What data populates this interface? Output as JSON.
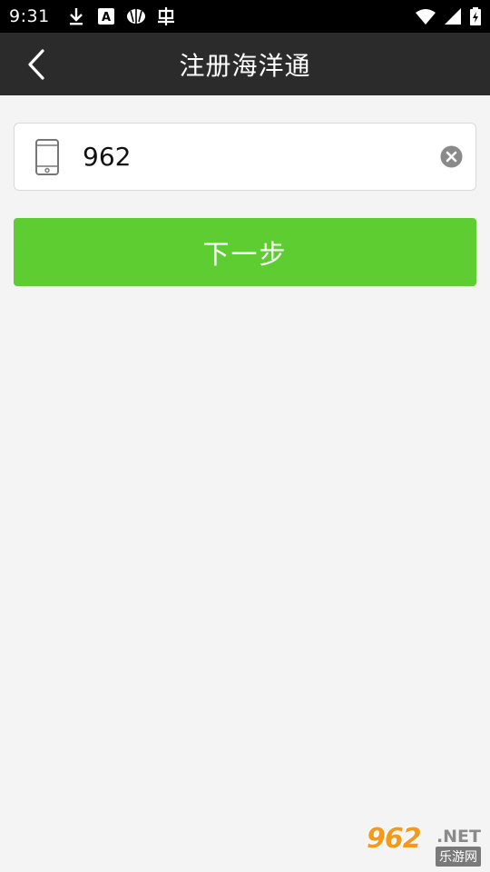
{
  "status_bar": {
    "time": "9:31",
    "left_icons": [
      "download-icon",
      "accessibility-a-icon",
      "app-shell-icon",
      "bug-icon"
    ],
    "right_icons": [
      "wifi-icon",
      "cellular-signal-icon",
      "battery-charging-icon"
    ]
  },
  "app_bar": {
    "title": "注册海洋通",
    "back_icon": "chevron-left-icon",
    "background": "#2b2b2b"
  },
  "phone_input": {
    "value": "962",
    "leading_icon": "mobile-phone-icon",
    "trailing_icon": "clear-icon"
  },
  "next_button": {
    "label": "下一步",
    "color": "#5dcd32"
  },
  "watermark": {
    "number": "962",
    "suffix": ".NET",
    "site": "乐游网"
  },
  "colors": {
    "page_background": "#f4f4f4",
    "accent_green": "#5dcd32"
  }
}
